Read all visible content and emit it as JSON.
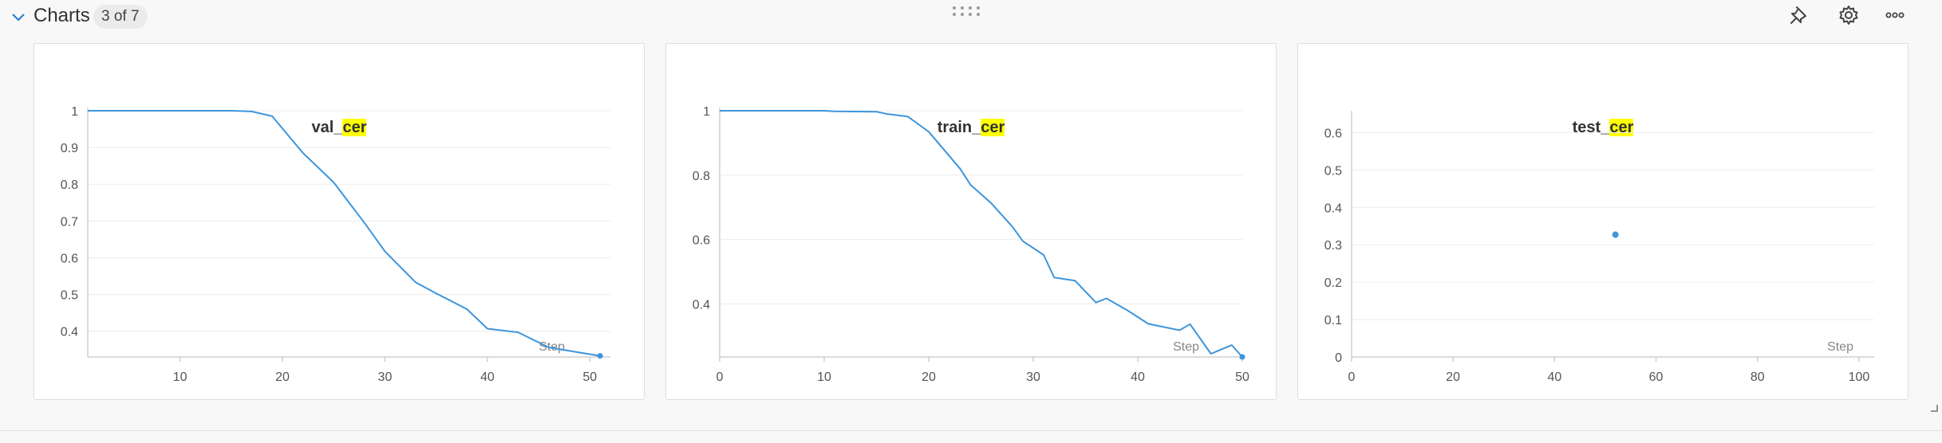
{
  "section": {
    "title": "Charts",
    "count": "3 of 7",
    "icons": [
      "chevron-down-icon",
      "drag-handle-icon",
      "pin-icon",
      "gear-icon",
      "more-icon"
    ]
  },
  "panels": [
    {
      "title_prefix": "val_",
      "title_highlight": "cer"
    },
    {
      "title_prefix": "train_",
      "title_highlight": "cer"
    },
    {
      "title_prefix": "test_",
      "title_highlight": "cer"
    }
  ],
  "chart_data": [
    {
      "type": "line",
      "title": "val_cer",
      "xlabel": "Step",
      "ylabel": "",
      "xlim": [
        1,
        52
      ],
      "ylim": [
        0.33,
        1.0
      ],
      "xticks": [
        10,
        20,
        30,
        40,
        50
      ],
      "yticks": [
        1,
        0.9,
        0.8,
        0.7,
        0.6,
        0.5,
        0.4
      ],
      "ytick_labels": [
        "1",
        "0.9",
        "0.8",
        "0.7",
        "0.6",
        "0.5",
        "0.4"
      ],
      "grid": true,
      "color": "#3d95dc",
      "series": [
        {
          "x": [
            1,
            5,
            10,
            15,
            17,
            19,
            22,
            25,
            28,
            30,
            33,
            35,
            38,
            40,
            43,
            46,
            49,
            51
          ],
          "y": [
            1,
            1,
            1,
            1,
            0.998,
            0.985,
            0.885,
            0.805,
            0.695,
            0.617,
            0.533,
            0.503,
            0.46,
            0.407,
            0.397,
            0.356,
            0.342,
            0.333
          ]
        }
      ],
      "end_marker": true
    },
    {
      "type": "line",
      "title": "train_cer",
      "xlabel": "Step",
      "ylabel": "",
      "xlim": [
        0,
        50
      ],
      "ylim": [
        0.235,
        1.0
      ],
      "xticks": [
        0,
        10,
        20,
        30,
        40,
        50
      ],
      "yticks": [
        1,
        0.8,
        0.6,
        0.4
      ],
      "ytick_labels": [
        "1",
        "0.8",
        "0.6",
        "0.4"
      ],
      "grid": true,
      "color": "#3d95dc",
      "series": [
        {
          "x": [
            0,
            5,
            10,
            11,
            15,
            16,
            18,
            20,
            23,
            24,
            26,
            28,
            29,
            31,
            32,
            34,
            36,
            37,
            39,
            41,
            44,
            45,
            47,
            49,
            50
          ],
          "y": [
            1,
            1,
            1,
            0.998,
            0.997,
            0.99,
            0.982,
            0.935,
            0.82,
            0.77,
            0.712,
            0.64,
            0.595,
            0.552,
            0.482,
            0.472,
            0.404,
            0.417,
            0.38,
            0.338,
            0.318,
            0.337,
            0.245,
            0.272,
            0.235
          ]
        }
      ],
      "end_marker": true
    },
    {
      "type": "scatter",
      "title": "test_cer",
      "xlabel": "Step",
      "ylabel": "",
      "xlim": [
        0,
        103
      ],
      "ylim": [
        0,
        0.65
      ],
      "xticks": [
        0,
        20,
        40,
        60,
        80,
        100
      ],
      "yticks": [
        0.6,
        0.5,
        0.4,
        0.3,
        0.2,
        0.1,
        0
      ],
      "ytick_labels": [
        "0.6",
        "0.5",
        "0.4",
        "0.3",
        "0.2",
        "0.1",
        "0"
      ],
      "grid": true,
      "color": "#3d95dc",
      "series": [
        {
          "x": [
            52
          ],
          "y": [
            0.327
          ]
        }
      ]
    }
  ]
}
